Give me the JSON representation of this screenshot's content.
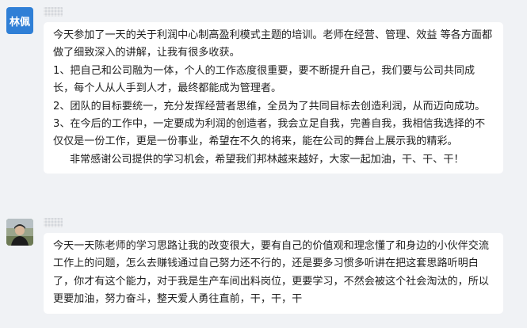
{
  "messages": [
    {
      "avatar_text": "林佩",
      "avatar_color": "#2f7fd6",
      "paragraphs": [
        "今天参加了一天的关于利润中心制高盈利模式主题的培训。老师在经营、管理、效益 等各方面都做了细致深入的讲解，让我有很多收获。",
        "1、把自己和公司融为一体，个人的工作态度很重要，要不断提升自己，我们要与公司共同成长，每个人从人手到人才，最终都能成为管理者。",
        "2、团队的目标要统一，充分发挥经营者思维，全员为了共同目标去创造利润，从而迈向成功。",
        "3、在今后的工作中，一定要成为利润的创造者，我会立足自我，完善自我，我相信我选择的不仅仅是一份工作，更是一份事业，希望在不久的将来，能在公司的舞台上展示我的精彩。",
        "非常感谢公司提供的学习机会，希望我们邦林越来越好，大家一起加油，干、干、干！"
      ]
    },
    {
      "avatar_icon": "person-photo-icon",
      "paragraphs": [
        "今天一天陈老师的学习思路让我的改变很大，要有自己的价值观和理念懂了和身边的小伙伴交流工作上的问题，怎么去赚钱通过自己努力还不行的，还是要多习惯多听讲在把这套思路听明白了，你才有这个能力，对于我是生产车间出料岗位，更要学习，不然会被这个社会淘汰的，所以更要加油，努力奋斗，整天爱人勇往直前，干，干，干"
      ]
    }
  ]
}
